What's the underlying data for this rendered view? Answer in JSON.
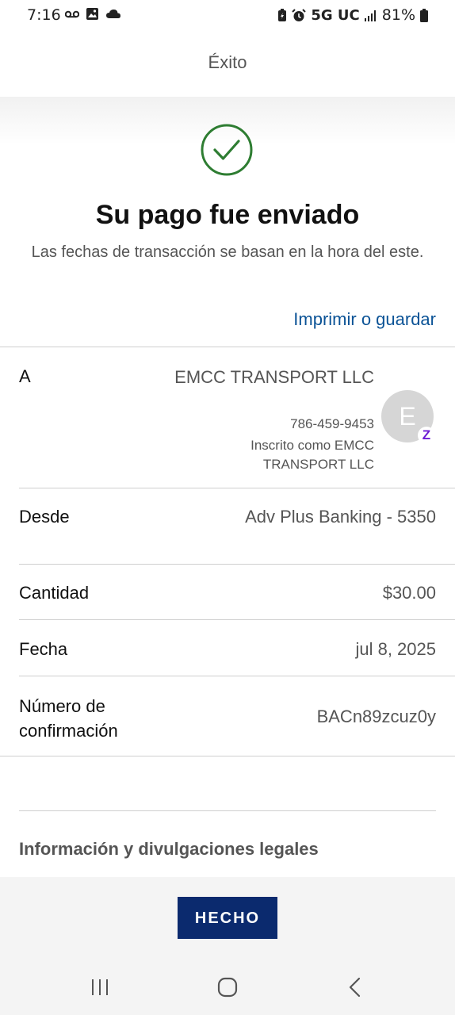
{
  "status_bar": {
    "time": "7:16",
    "network": "5G UC",
    "battery": "81%",
    "icons_left": [
      "voicemail-icon",
      "image-icon",
      "cloud-icon"
    ],
    "icons_right": [
      "battery-saver-icon",
      "alarm-icon",
      "signal-icon",
      "battery-icon"
    ]
  },
  "header": {
    "title": "Éxito"
  },
  "confirmation": {
    "icon": "check-circle-icon",
    "icon_color": "#2e7d32",
    "title": "Su pago fue enviado",
    "subtitle": "Las fechas de transacción se basan en la hora del este.",
    "print_link": "Imprimir o guardar"
  },
  "details": {
    "to": {
      "label": "A",
      "name": "EMCC TRANSPORT LLC",
      "phone": "786-459-9453",
      "enrolled_as": "Inscrito como EMCC TRANSPORT LLC",
      "avatar_initial": "E",
      "badge": "Z"
    },
    "from": {
      "label": "Desde",
      "value": "Adv Plus Banking - 5350"
    },
    "amount": {
      "label": "Cantidad",
      "value": "$30.00"
    },
    "date": {
      "label": "Fecha",
      "value": "jul 8, 2025"
    },
    "confirmation_number": {
      "label": "Número de confirmación",
      "value": "BACn89zcuz0y"
    }
  },
  "legal": {
    "label": "Información y divulgaciones legales"
  },
  "footer": {
    "done_button": "HECHO",
    "button_color": "#0b2a6e"
  },
  "nav_bar": {
    "icons": [
      "recent-apps-icon",
      "home-icon",
      "back-icon"
    ]
  },
  "colors": {
    "link": "#0b5396",
    "accent_purple": "#6d1ed4"
  }
}
